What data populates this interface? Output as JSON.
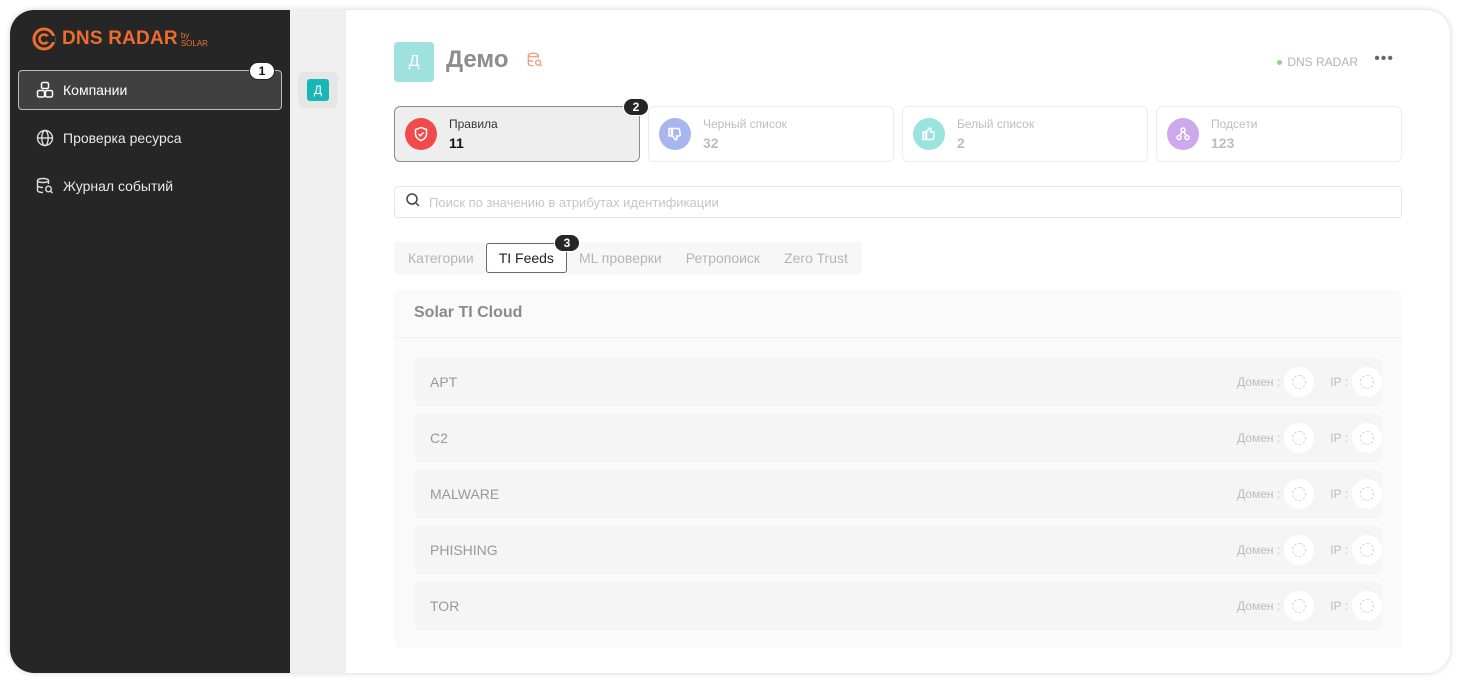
{
  "brand": {
    "name": "DNS RADAR",
    "by": "by",
    "sub": "SOLAR",
    "accent": "#ef6c2f"
  },
  "sidebar": {
    "items": [
      {
        "label": "Компании",
        "icon": "companies-icon",
        "active": true,
        "badge": "1"
      },
      {
        "label": "Проверка ресурса",
        "icon": "globe-icon",
        "active": false
      },
      {
        "label": "Журнал событий",
        "icon": "event-log-icon",
        "active": false
      }
    ]
  },
  "rail": {
    "company_initial": "Д",
    "company_color": "#18b7b5"
  },
  "header": {
    "avatar_initial": "Д",
    "title": "Демо",
    "status": "DNS RADAR",
    "more": "•••"
  },
  "cards": [
    {
      "label": "Правила",
      "value": "11",
      "icon": "shield-icon",
      "color": "#f04a4a",
      "active": true,
      "badge": "2"
    },
    {
      "label": "Черный список",
      "value": "32",
      "icon": "thumb-down-icon",
      "color": "#a9b5ee",
      "active": false
    },
    {
      "label": "Белый список",
      "value": "2",
      "icon": "thumb-up-icon",
      "color": "#9be3df",
      "active": false
    },
    {
      "label": "Подсети",
      "value": "123",
      "icon": "subnet-icon",
      "color": "#cda9ec",
      "active": false
    }
  ],
  "search": {
    "placeholder": "Поиск по значению в атрибутах идентификации"
  },
  "tabs": [
    {
      "label": "Категории",
      "active": false
    },
    {
      "label": "TI Feeds",
      "active": true,
      "badge": "3"
    },
    {
      "label": "ML проверки",
      "active": false
    },
    {
      "label": "Ретропоиск",
      "active": false
    },
    {
      "label": "Zero Trust",
      "active": false
    }
  ],
  "panel": {
    "title": "Solar TI Cloud",
    "domain_label": "Домен :",
    "ip_label": "IP :",
    "feeds": [
      "APT",
      "C2",
      "MALWARE",
      "PHISHING",
      "TOR"
    ]
  }
}
